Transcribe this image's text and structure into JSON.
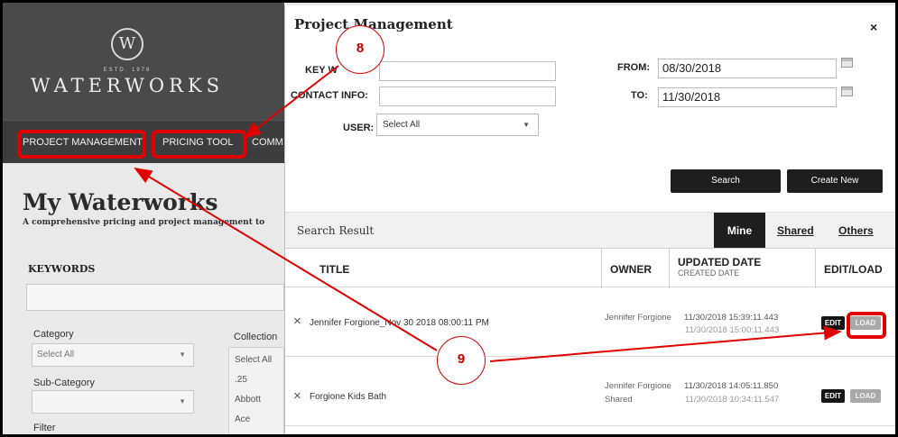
{
  "site": {
    "logo_letter": "W",
    "logo_estd": "ESTD. 1978",
    "logo_word": "WATERWORKS",
    "nav": [
      "PROJECT MANAGEMENT",
      "PRICING TOOL",
      "COMM"
    ],
    "page_title": "My Waterworks",
    "page_subtitle": "A comprehensive pricing and project management to",
    "keywords_label": "KEYWORDS",
    "category_label": "Category",
    "category_value": "Select All",
    "subcategory_label": "Sub-Category",
    "collection_label": "Collection",
    "collection_items": [
      "Select All",
      ".25",
      "Abbott",
      "Ace"
    ],
    "filter_label": "Filter"
  },
  "modal": {
    "title": "Project Management",
    "close": "×",
    "keywords_label": "KEY W",
    "contact_label": "CONTACT INFO:",
    "user_label": "USER:",
    "user_value": "Select All",
    "from_label": "FROM:",
    "from_value": "08/30/2018",
    "to_label": "TO:",
    "to_value": "11/30/2018",
    "search_button": "Search",
    "create_button": "Create New",
    "search_result_title": "Search Result",
    "tabs": {
      "mine": "Mine",
      "shared": "Shared",
      "others": "Others"
    },
    "columns": {
      "title": "TITLE",
      "owner": "OWNER",
      "updated": "UPDATED DATE",
      "created": "CREATED DATE",
      "editload": "EDIT/LOAD"
    },
    "rows": [
      {
        "title": "Jennifer Forgione_Nov 30 2018 08:00:11 PM",
        "owner": "Jennifer Forgione",
        "owner_sub": "",
        "updated": "11/30/2018 15:39:11.443",
        "created": "11/30/2018 15:00:11.443",
        "edit": "EDIT",
        "load": "LOAD"
      },
      {
        "title": "Forgione Kids Bath",
        "owner": "Jennifer Forgione",
        "owner_sub": "Shared",
        "updated": "11/30/2018 14:05:11.850",
        "created": "11/30/2018 10:34:11.547",
        "edit": "EDIT",
        "load": "LOAD"
      }
    ]
  },
  "annotations": {
    "callout_8": "8",
    "callout_9": "9",
    "color": "#e00000"
  }
}
